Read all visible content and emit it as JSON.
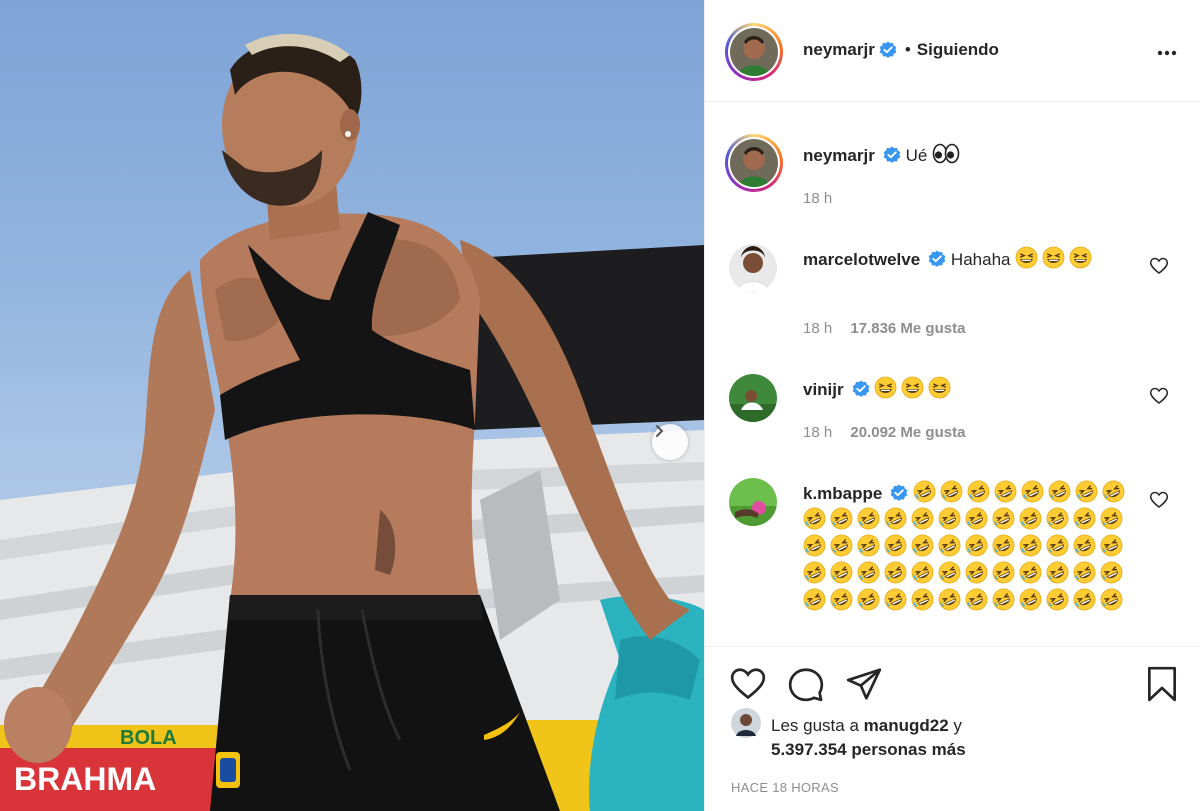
{
  "post": {
    "author": "neymarjr",
    "follow_state": "Siguiendo",
    "separator": "•",
    "caption": {
      "username": "neymarjr",
      "text": "Ué",
      "emoji": "eyes-emoji",
      "time": "18 h"
    }
  },
  "comments": [
    {
      "username": "marcelotwelve",
      "verified": true,
      "text": "Hahaha",
      "emoji": "grinning-squinting-face-emoji",
      "emoji_count": 3,
      "time": "18 h",
      "likes": "17.836 Me gusta"
    },
    {
      "username": "vinijr",
      "verified": true,
      "text": "",
      "emoji": "grinning-squinting-face-emoji",
      "emoji_count": 3,
      "time": "18 h",
      "likes": "20.092 Me gusta"
    },
    {
      "username": "k.mbappe",
      "verified": true,
      "text": "",
      "emoji": "rolling-on-floor-laughing-emoji",
      "emoji_count": 56
    }
  ],
  "likes_summary": {
    "prefix": "Les gusta a",
    "user": "manugd22",
    "conjunction": "y",
    "count_text": "5.397.354 personas más"
  },
  "timestamp": "HACE 18 HORAS",
  "photo": {
    "banner_text": "BRAHMA",
    "banner_partial": "BOLA"
  },
  "colors": {
    "verified": "#3897f0",
    "muted": "#8e8e8e",
    "text": "#262626",
    "sky": "#8fb2de"
  }
}
